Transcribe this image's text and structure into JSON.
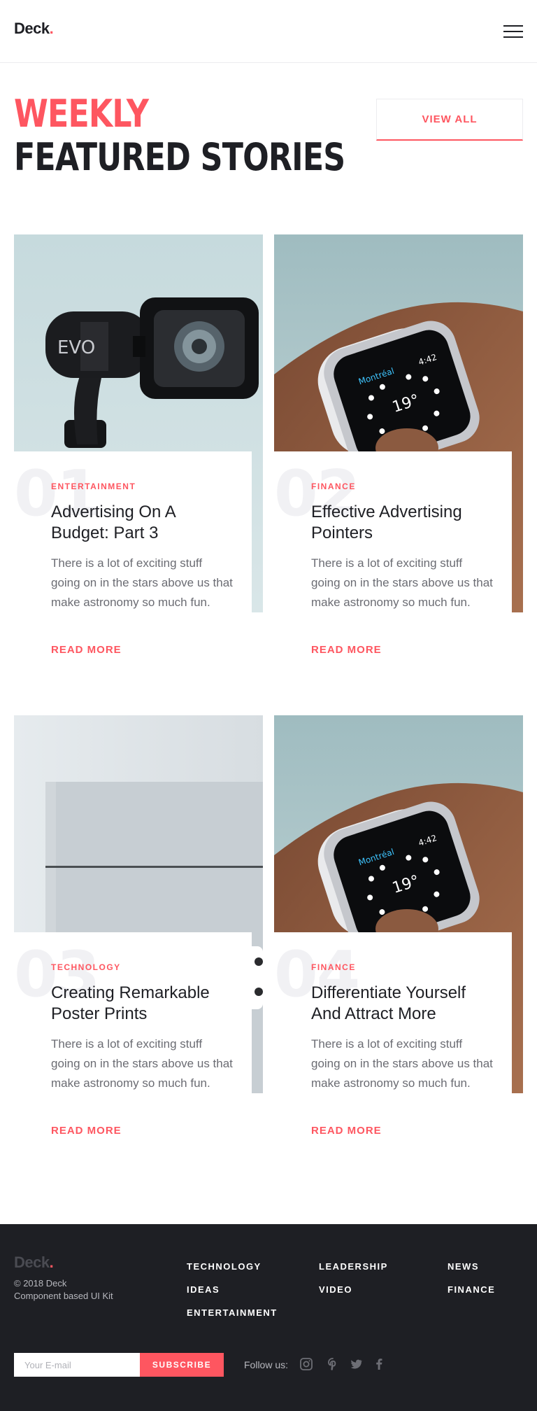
{
  "header": {
    "logo_text": "Deck",
    "logo_dot": "."
  },
  "hero": {
    "line1": "WEEKLY",
    "line2": "FEATURED STORIES",
    "view_all": "VIEW ALL"
  },
  "cards": [
    {
      "num": "01",
      "category": "ENTERTAINMENT",
      "title": "Advertising On A Budget: Part 3",
      "desc": "There is a lot of exciting stuff going on in the stars above us that make astronomy so much fun.",
      "read_more": "READ MORE"
    },
    {
      "num": "02",
      "category": "FINANCE",
      "title": "Effective Advertising Pointers",
      "desc": "There is a lot of exciting stuff going on in the stars above us that make astronomy so much fun.",
      "read_more": "READ MORE"
    },
    {
      "num": "03",
      "category": "TECHNOLOGY",
      "title": "Creating Remarkable Poster Prints",
      "desc": "There is a lot of exciting stuff going on in the stars above us that make astronomy so much fun.",
      "read_more": "READ MORE"
    },
    {
      "num": "04",
      "category": "FINANCE",
      "title": "Differentiate Yourself And Attract More",
      "desc": "There is a lot of exciting stuff going on in the stars above us that make astronomy so much fun.",
      "read_more": "READ MORE"
    }
  ],
  "images": {
    "camera_brand": "EVO",
    "watch_city": "Montréal",
    "watch_time": "4:42",
    "watch_temp": "19°"
  },
  "footer": {
    "logo_text": "Deck",
    "logo_dot": ".",
    "copyright": "© 2018 Deck",
    "tagline": "Component based UI Kit",
    "links": [
      "TECHNOLOGY",
      "LEADERSHIP",
      "NEWS",
      "IDEAS",
      "VIDEO",
      "FINANCE",
      "ENTERTAINMENT"
    ],
    "email_placeholder": "Your E-mail",
    "subscribe": "SUBSCRIBE",
    "follow_label": "Follow us:",
    "social_icons": [
      "instagram-icon",
      "pinterest-icon",
      "twitter-icon",
      "facebook-icon"
    ]
  },
  "colors": {
    "accent": "#fe5660",
    "dark": "#1e1f24",
    "muted": "#6b6c73"
  }
}
